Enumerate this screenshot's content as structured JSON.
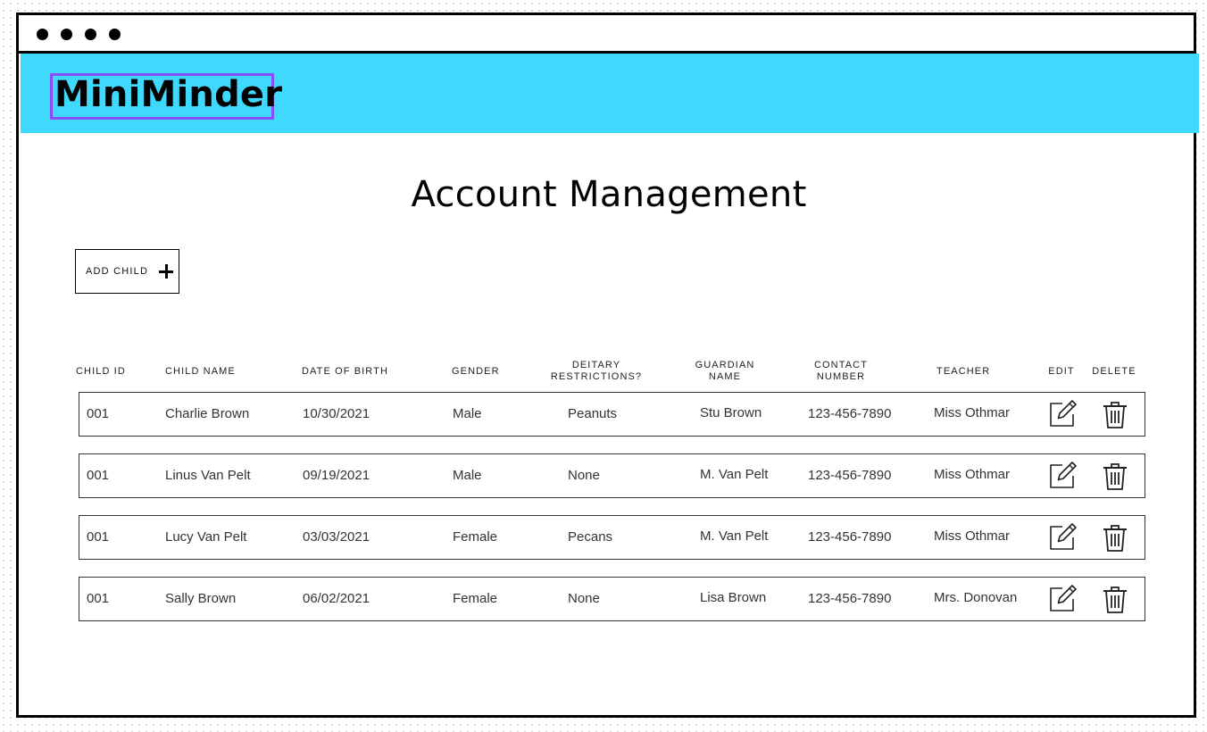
{
  "app": {
    "name": "MiniMinder"
  },
  "page": {
    "title": "Account Management"
  },
  "actions": {
    "add_child_label": "ADD CHILD"
  },
  "table": {
    "columns": [
      {
        "key": "child_id",
        "line1": "CHILD ID",
        "line2": ""
      },
      {
        "key": "child_name",
        "line1": "CHILD NAME",
        "line2": ""
      },
      {
        "key": "dob",
        "line1": "DATE OF BIRTH",
        "line2": ""
      },
      {
        "key": "gender",
        "line1": "GENDER",
        "line2": ""
      },
      {
        "key": "dietary",
        "line1": "DEITARY",
        "line2": "RESTRICTIONS?"
      },
      {
        "key": "guardian",
        "line1": "GUARDIAN",
        "line2": "NAME"
      },
      {
        "key": "contact",
        "line1": "CONTACT",
        "line2": "NUMBER"
      },
      {
        "key": "teacher",
        "line1": "TEACHER",
        "line2": ""
      },
      {
        "key": "edit",
        "line1": "EDIT",
        "line2": ""
      },
      {
        "key": "delete",
        "line1": "DELETE",
        "line2": ""
      }
    ],
    "rows": [
      {
        "child_id": "001",
        "child_name": "Charlie Brown",
        "dob": "10/30/2021",
        "gender": "Male",
        "dietary": "Peanuts",
        "guardian": "Stu Brown",
        "contact": "123-456-7890",
        "teacher": "Miss Othmar"
      },
      {
        "child_id": "001",
        "child_name": "Linus Van Pelt",
        "dob": "09/19/2021",
        "gender": "Male",
        "dietary": "None",
        "guardian": "M. Van Pelt",
        "contact": "123-456-7890",
        "teacher": "Miss Othmar"
      },
      {
        "child_id": "001",
        "child_name": "Lucy Van Pelt",
        "dob": "03/03/2021",
        "gender": "Female",
        "dietary": "Pecans",
        "guardian": "M. Van Pelt",
        "contact": "123-456-7890",
        "teacher": "Miss Othmar"
      },
      {
        "child_id": "001",
        "child_name": "Sally Brown",
        "dob": "06/02/2021",
        "gender": "Female",
        "dietary": "None",
        "guardian": "Lisa Brown",
        "contact": "123-456-7890",
        "teacher": "Mrs. Donovan"
      }
    ]
  },
  "icons": {
    "window_controls": "window-dots-icon",
    "add": "plus-icon",
    "edit": "edit-icon",
    "delete": "trash-icon"
  },
  "colors": {
    "header_bg": "#3ed9fd",
    "logo_outline": "#8a4dfc"
  }
}
